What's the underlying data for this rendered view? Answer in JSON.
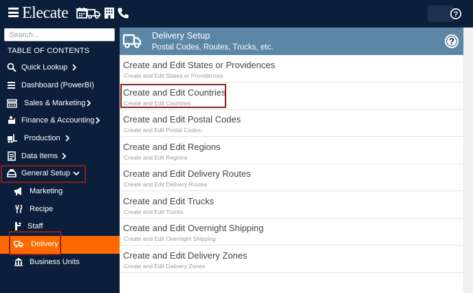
{
  "topbar": {
    "app_name": "Elecate",
    "icons": [
      "hamburger-icon",
      "calendar-icon",
      "truck-icon",
      "building-icon",
      "phone-icon",
      "help-icon"
    ]
  },
  "sidebar": {
    "search_placeholder": "Search...",
    "toc_title": "TABLE OF CONTENTS",
    "items": [
      {
        "label": "Quick Lookup",
        "icon": "search-icon",
        "chevron": "right"
      },
      {
        "label": "Dashboard (PowerBI)",
        "icon": "list-icon"
      },
      {
        "label": "Sales & Marketing",
        "icon": "cash-register-icon",
        "chevron": "right"
      },
      {
        "label": "Finance & Accounting",
        "icon": "finance-icon",
        "chevron": "right"
      },
      {
        "label": "Production",
        "icon": "forklift-icon",
        "chevron": "right"
      },
      {
        "label": "Data Items",
        "icon": "data-items-icon",
        "chevron": "right"
      },
      {
        "label": "General Setup",
        "icon": "setup-icon",
        "chevron": "down",
        "highlighted": true
      },
      {
        "label": "Marketing",
        "icon": "megaphone-icon",
        "sub": true
      },
      {
        "label": "Recipe",
        "icon": "recipe-icon",
        "sub": true
      },
      {
        "label": "Staff",
        "icon": "staff-icon",
        "sub": true
      },
      {
        "label": "Delivery",
        "icon": "truck-icon",
        "sub": true,
        "active": true,
        "highlighted": true
      },
      {
        "label": "Business Units",
        "icon": "business-units-icon",
        "sub": true
      }
    ],
    "active_color": "#ff6a00",
    "highlight_color": "#8b1e1e"
  },
  "main": {
    "header": {
      "title": "Delivery Setup",
      "subtitle": "Postal Codes, Routes, Trucks, etc.",
      "color": "#5b86a6"
    },
    "rows": [
      {
        "title": "Create and Edit States or Providences",
        "desc": "Create and Edit States or Providences"
      },
      {
        "title": "Create and Edit Countries",
        "desc": "Create and Edit Countries",
        "highlighted": true
      },
      {
        "title": "Create and Edit Postal Codes",
        "desc": "Create and Edit Postal Codes"
      },
      {
        "title": "Create and Edit Regions",
        "desc": "Create and Edit Regions"
      },
      {
        "title": "Create and Edit Delivery Routes",
        "desc": "Create and Edit Delivery Routes"
      },
      {
        "title": "Create and Edit Trucks",
        "desc": "Create and Edit Trucks"
      },
      {
        "title": "Create and Edit Overnight Shipping",
        "desc": "Create and Edit Overnight Shipping"
      },
      {
        "title": "Create and Edit Delivery Zones",
        "desc": "Create and Edit Delivery Zones"
      }
    ]
  }
}
